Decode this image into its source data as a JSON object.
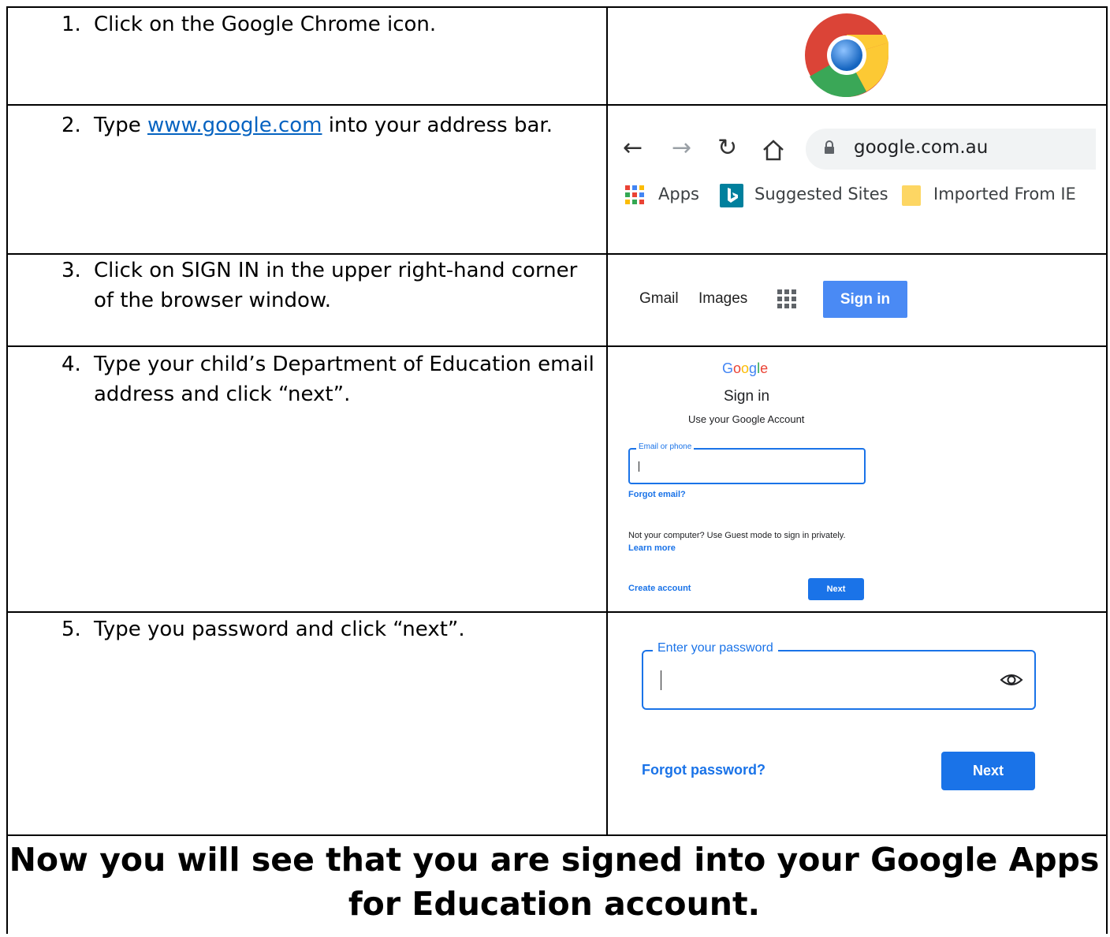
{
  "steps": [
    {
      "number": "1.",
      "text": "Click on the Google Chrome icon."
    },
    {
      "number": "2.",
      "text_before": "Type ",
      "link": "www.google.com",
      "text_after": " into your address bar."
    },
    {
      "number": "3.",
      "line1": "Click on SIGN IN in the upper right-hand corner",
      "line2": "of the browser window."
    },
    {
      "number": "4.",
      "line1": "Type your child’s Department of Education email",
      "line2": "address and click “next”."
    },
    {
      "number": "5.",
      "text": "Type you password and click “next”."
    }
  ],
  "browser": {
    "url": "google.com.au",
    "bookmarks": [
      "Apps",
      "Suggested Sites",
      "Imported From IE"
    ]
  },
  "google_header": {
    "gmail": "Gmail",
    "images": "Images",
    "signin": "Sign in"
  },
  "signin_form": {
    "logo": "Google",
    "title": "Sign in",
    "subtitle": "Use your Google Account",
    "email_label": "Email or phone",
    "forgot_email": "Forgot email?",
    "guest_note": "Not your computer? Use Guest mode to sign in privately.",
    "learn_more": "Learn more",
    "create_account": "Create account",
    "next": "Next"
  },
  "password_form": {
    "label": "Enter your password",
    "forgot": "Forgot password?",
    "next": "Next"
  },
  "final_message": {
    "line1": "Now you will see that you are signed into your Google Apps",
    "line2": "for Education account."
  },
  "colors": {
    "link": "#0563c1",
    "google_blue": "#1a73e8",
    "signin_button": "#4a8af4"
  }
}
